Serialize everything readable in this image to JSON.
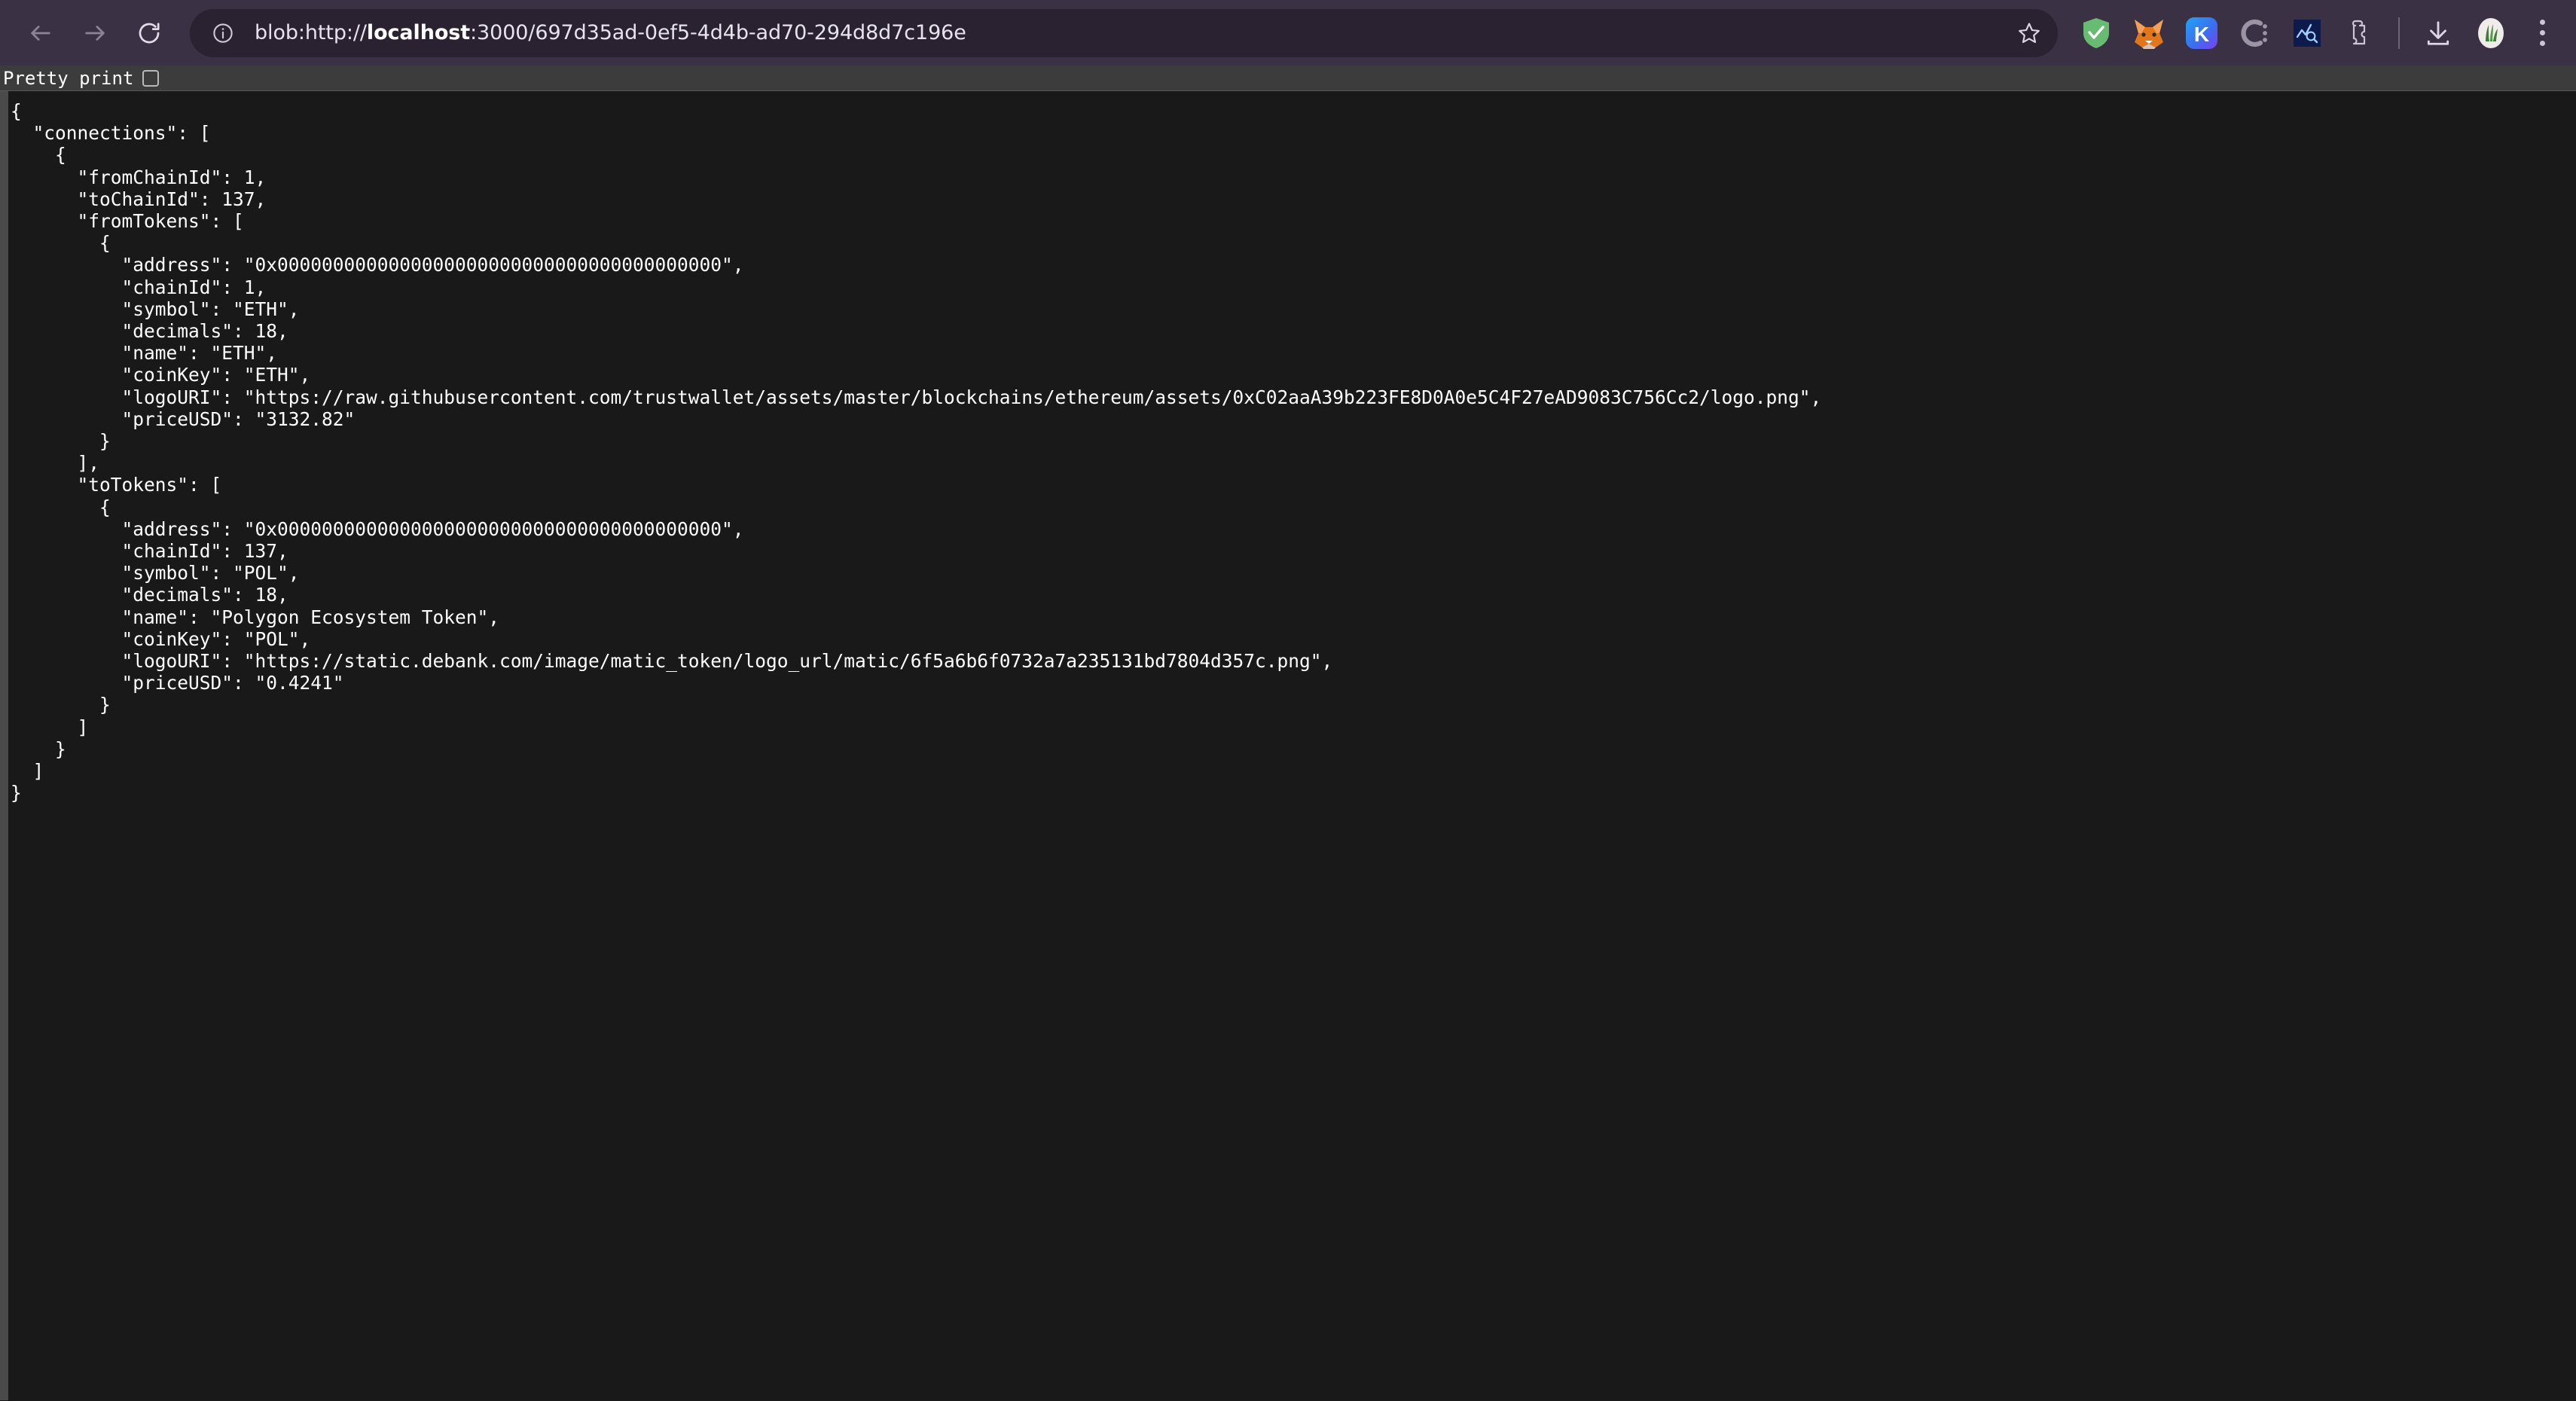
{
  "browser": {
    "back_label": "Back",
    "forward_label": "Forward",
    "reload_label": "Reload",
    "site_info_label": "View site information",
    "url_full": "blob:http://localhost:3000/697d35ad-0ef5-4d4b-ad70-294d8d7c196e",
    "url_prefix": "blob:http://",
    "url_host": "localhost",
    "url_suffix": ":3000/697d35ad-0ef5-4d4b-ad70-294d8d7c196e",
    "bookmark_label": "Bookmark this tab",
    "chrome_bg": "#3b3145",
    "omnibox_bg": "#2a2230",
    "extensions": [
      {
        "name": "adguard-shield-icon",
        "title": "AdGuard",
        "color": "#68bc71"
      },
      {
        "name": "metamask-fox-icon",
        "title": "MetaMask",
        "color": "#e2761b"
      },
      {
        "name": "keplr-icon",
        "title": "Keplr",
        "letter": "K",
        "color": "#3b82f6"
      },
      {
        "name": "coinbase-wallet-icon",
        "title": "Wallet extension",
        "letter": "C",
        "color": "#9b94a3"
      },
      {
        "name": "chart-analytics-icon",
        "title": "Analytics extension",
        "color": "#0d1b4c"
      },
      {
        "name": "extensions-puzzle-icon",
        "title": "Extensions",
        "color": "#cdc5d6"
      }
    ],
    "downloads_label": "Downloads",
    "profile_label": "Profile",
    "menu_label": "Customize and control Chrome"
  },
  "toolbar": {
    "pretty_print_label": "Pretty print",
    "pretty_print_checked": false
  },
  "json_document": {
    "raw": "{\n  \"connections\": [\n    {\n      \"fromChainId\": 1,\n      \"toChainId\": 137,\n      \"fromTokens\": [\n        {\n          \"address\": \"0x0000000000000000000000000000000000000000\",\n          \"chainId\": 1,\n          \"symbol\": \"ETH\",\n          \"decimals\": 18,\n          \"name\": \"ETH\",\n          \"coinKey\": \"ETH\",\n          \"logoURI\": \"https://raw.githubusercontent.com/trustwallet/assets/master/blockchains/ethereum/assets/0xC02aaA39b223FE8D0A0e5C4F27eAD9083C756Cc2/logo.png\",\n          \"priceUSD\": \"3132.82\"\n        }\n      ],\n      \"toTokens\": [\n        {\n          \"address\": \"0x0000000000000000000000000000000000000000\",\n          \"chainId\": 137,\n          \"symbol\": \"POL\",\n          \"decimals\": 18,\n          \"name\": \"Polygon Ecosystem Token\",\n          \"coinKey\": \"POL\",\n          \"logoURI\": \"https://static.debank.com/image/matic_token/logo_url/matic/6f5a6b6f0732a7a235131bd7804d357c.png\",\n          \"priceUSD\": \"0.4241\"\n        }\n      ]\n    }\n  ]\n}",
    "parsed": {
      "connections": [
        {
          "fromChainId": 1,
          "toChainId": 137,
          "fromTokens": [
            {
              "address": "0x0000000000000000000000000000000000000000",
              "chainId": 1,
              "symbol": "ETH",
              "decimals": 18,
              "name": "ETH",
              "coinKey": "ETH",
              "logoURI": "https://raw.githubusercontent.com/trustwallet/assets/master/blockchains/ethereum/assets/0xC02aaA39b223FE8D0A0e5C4F27eAD9083C756Cc2/logo.png",
              "priceUSD": "3132.82"
            }
          ],
          "toTokens": [
            {
              "address": "0x0000000000000000000000000000000000000000",
              "chainId": 137,
              "symbol": "POL",
              "decimals": 18,
              "name": "Polygon Ecosystem Token",
              "coinKey": "POL",
              "logoURI": "https://static.debank.com/image/matic_token/logo_url/matic/6f5a6b6f0732a7a235131bd7804d357c.png",
              "priceUSD": "0.4241"
            }
          ]
        }
      ]
    }
  }
}
